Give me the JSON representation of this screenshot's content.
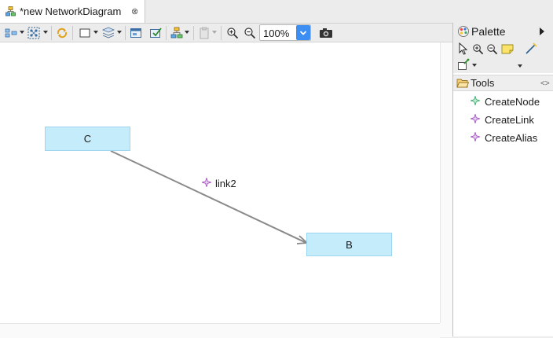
{
  "tab": {
    "title": "*new NetworkDiagram",
    "close": "⊗"
  },
  "toolbar": {
    "zoom_value": "100%"
  },
  "diagram": {
    "nodes": [
      {
        "label": "C"
      },
      {
        "label": "B"
      }
    ],
    "link": {
      "label": "link2"
    }
  },
  "palette": {
    "title": "Palette",
    "drawer": {
      "label": "Tools"
    },
    "items": [
      {
        "label": "CreateNode",
        "color": "#3aa86b"
      },
      {
        "label": "CreateLink",
        "color": "#a24fbf"
      },
      {
        "label": "CreateAlias",
        "color": "#a24fbf"
      }
    ]
  },
  "colors": {
    "node_fill": "#c4ecfb",
    "node_border": "#9ed6f2",
    "link": "#8a8a8a",
    "zoom_button": "#3d8ef2"
  }
}
